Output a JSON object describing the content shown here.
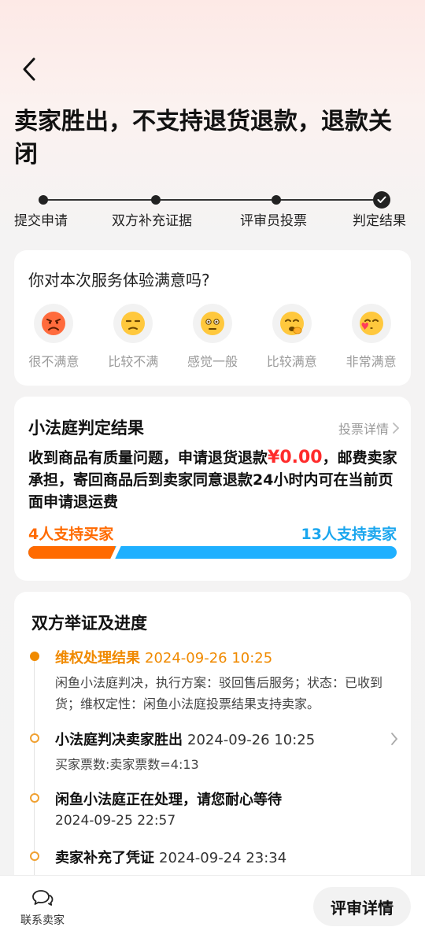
{
  "header": {
    "title": "卖家胜出，不支持退货退款，退款关闭"
  },
  "steps": [
    {
      "label": "提交申请",
      "state": "done"
    },
    {
      "label": "双方补充证据",
      "state": "done"
    },
    {
      "label": "评审员投票",
      "state": "done"
    },
    {
      "label": "判定结果",
      "state": "current"
    }
  ],
  "survey": {
    "question": "你对本次服务体验满意吗?",
    "options": [
      {
        "label": "很不满意",
        "icon": "angry-face-icon"
      },
      {
        "label": "比较不满",
        "icon": "unamused-face-icon"
      },
      {
        "label": "感觉一般",
        "icon": "neutral-face-icon"
      },
      {
        "label": "比较满意",
        "icon": "smiling-hand-face-icon"
      },
      {
        "label": "非常满意",
        "icon": "heart-kiss-face-icon"
      }
    ]
  },
  "verdict": {
    "title": "小法庭判定结果",
    "vote_link": "投票详情",
    "text_before": "收到商品有质量问题，申请退货退款",
    "amount": "¥0.00",
    "text_after": "，邮费卖家承担，寄回商品后到卖家同意退款24小时内可在当前页面申请退运费",
    "buyer_votes_label": "4人支持买家",
    "seller_votes_label": "13人支持卖家",
    "buyer_votes": 4,
    "seller_votes": 13,
    "colors": {
      "buyer": "#ff6a00",
      "seller": "#1fb0ff"
    }
  },
  "evidence": {
    "title": "双方举证及进度",
    "items": [
      {
        "title": "维权处理结果",
        "time": "2024-09-26 10:25",
        "detail": "闲鱼小法庭判决，执行方案：驳回售后服务；状态：已收到货；维权定性：闲鱼小法庭投票结果支持卖家。"
      },
      {
        "title": "小法庭判决卖家胜出",
        "time": "2024-09-26 10:25",
        "detail": "买家票数:卖家票数=4:13"
      },
      {
        "title": "闲鱼小法庭正在处理，请您耐心等待",
        "time": "",
        "detail": "2024-09-25 22:57"
      },
      {
        "title": "卖家补充了凭证",
        "time": "2024-09-24 23:34",
        "detail": ""
      }
    ]
  },
  "bottom": {
    "contact_label": "联系卖家",
    "review_button": "评审详情"
  }
}
